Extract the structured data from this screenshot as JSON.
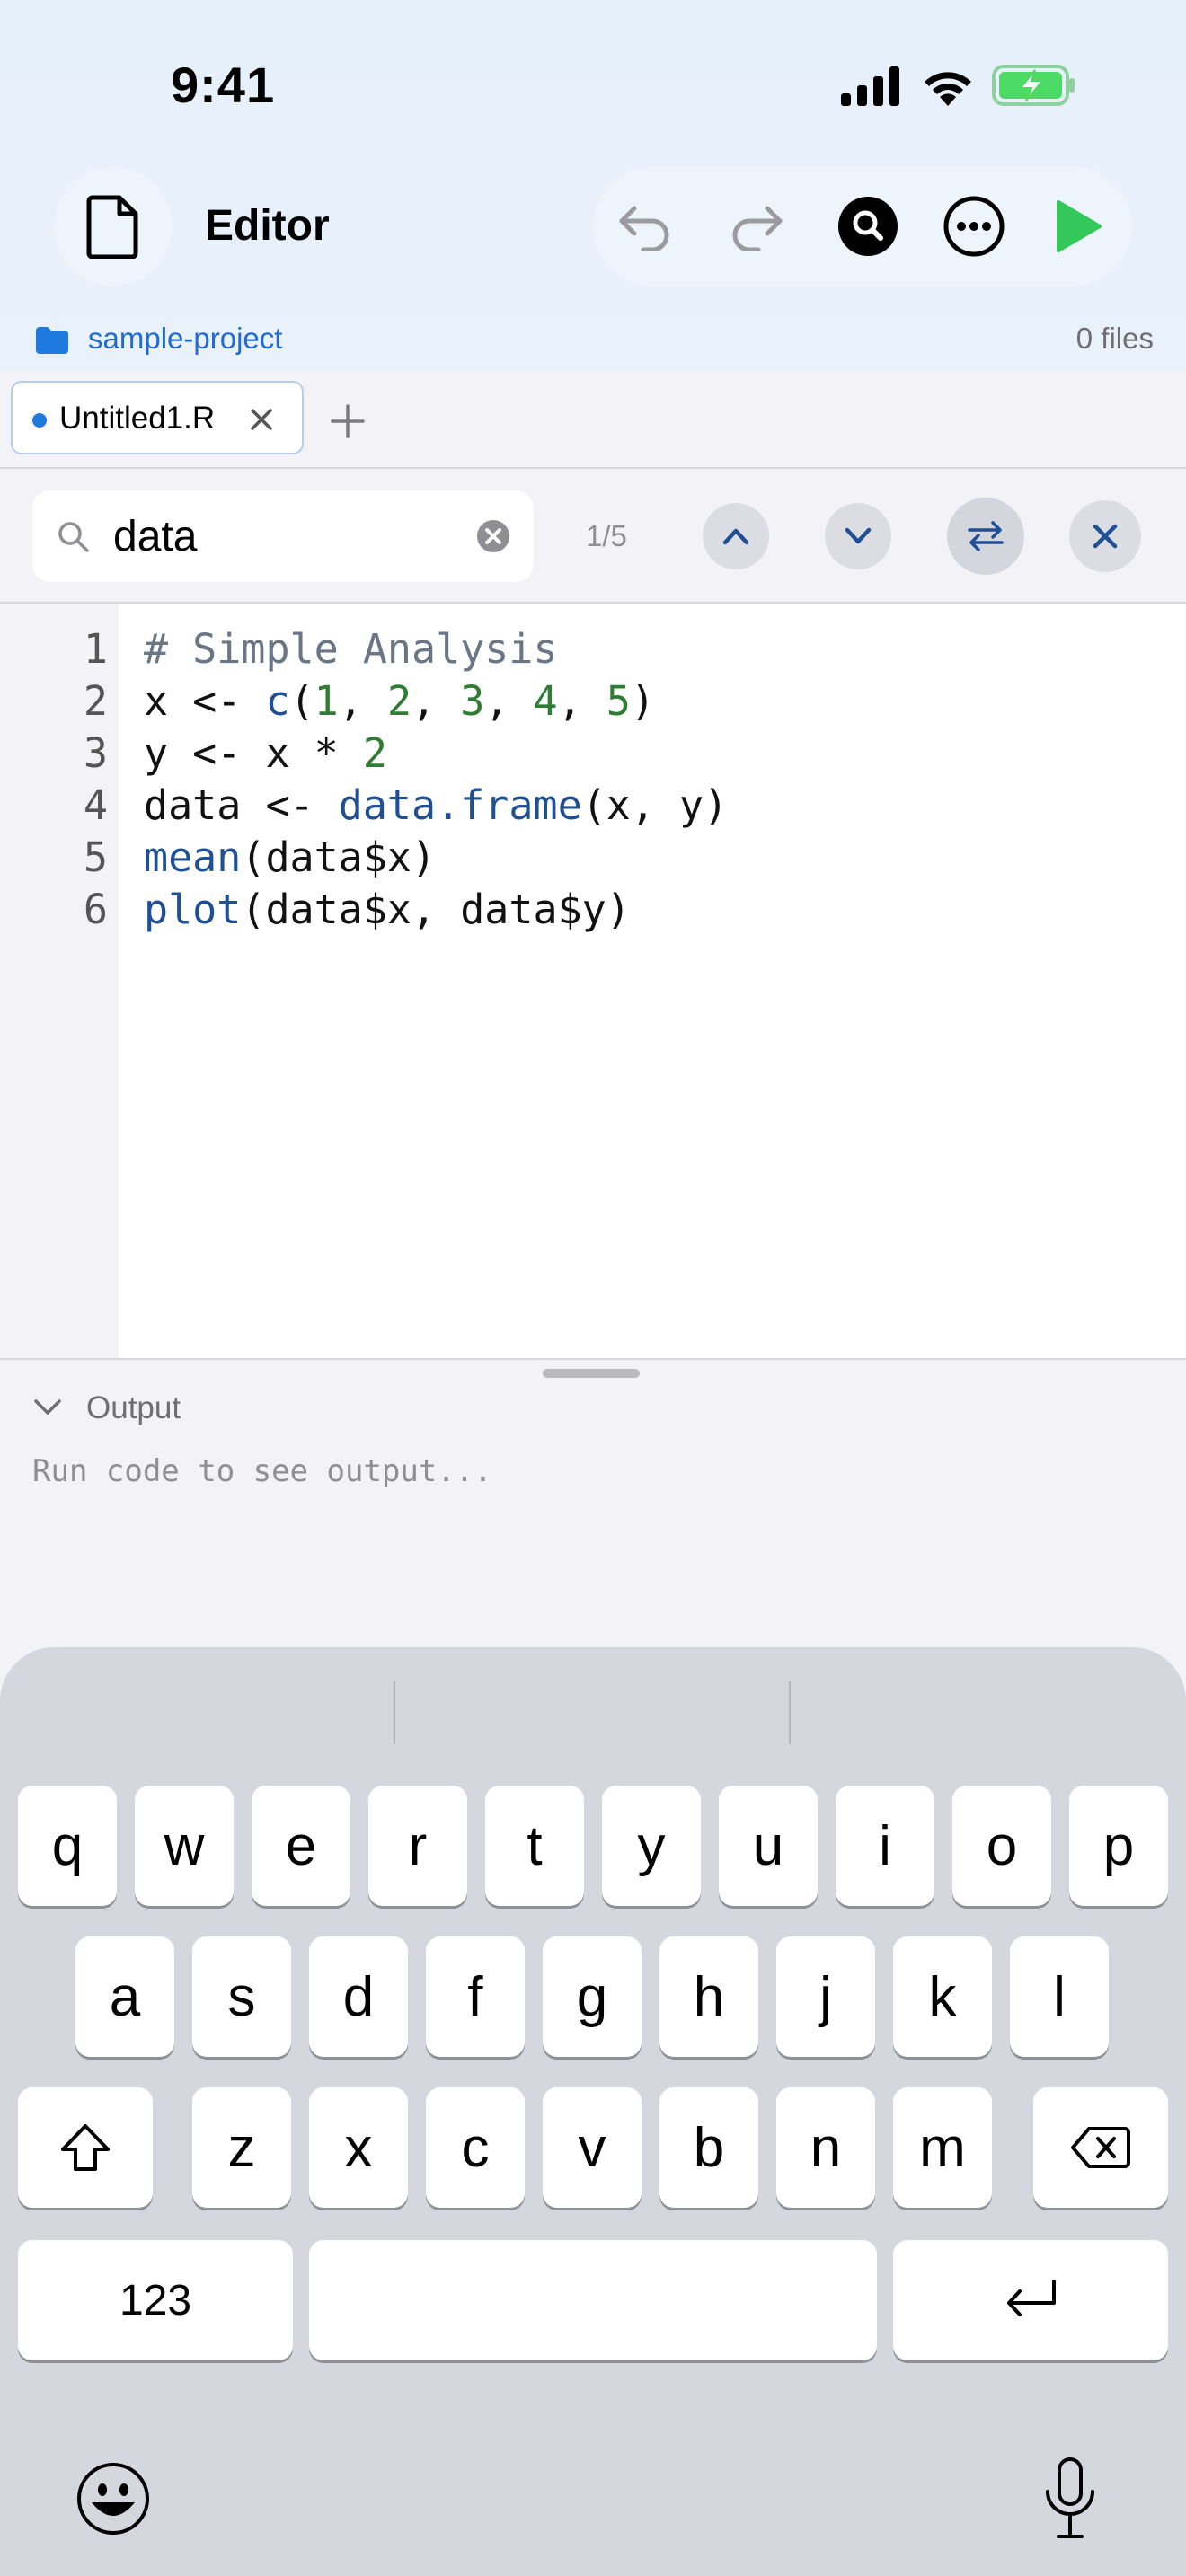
{
  "status_bar": {
    "time": "9:41"
  },
  "header": {
    "title": "Editor"
  },
  "toolbar": {
    "undo": "undo-icon",
    "redo": "redo-icon",
    "search": "search-icon",
    "more": "more-icon",
    "run": "run-icon",
    "run_color": "#34c759"
  },
  "project": {
    "name": "sample-project",
    "file_count": "0 files"
  },
  "tabs": [
    {
      "label": "Untitled1.R",
      "modified": true
    }
  ],
  "find": {
    "query": "data",
    "match_count": "1/5"
  },
  "code_lines": [
    {
      "num": "1",
      "text": "# Simple Analysis"
    },
    {
      "num": "2",
      "text": "x <- c(1, 2, 3, 4, 5)"
    },
    {
      "num": "3",
      "text": "y <- x * 2"
    },
    {
      "num": "4",
      "text": "data <- data.frame(x, y)"
    },
    {
      "num": "5",
      "text": "mean(data$x)"
    },
    {
      "num": "6",
      "text": "plot(data$x, data$y)"
    }
  ],
  "output": {
    "label": "Output",
    "placeholder": "Run code to see output..."
  },
  "keyboard": {
    "row1": [
      "q",
      "w",
      "e",
      "r",
      "t",
      "y",
      "u",
      "i",
      "o",
      "p"
    ],
    "row2": [
      "a",
      "s",
      "d",
      "f",
      "g",
      "h",
      "j",
      "k",
      "l"
    ],
    "row3": [
      "z",
      "x",
      "c",
      "v",
      "b",
      "n",
      "m"
    ],
    "numbers_label": "123"
  }
}
